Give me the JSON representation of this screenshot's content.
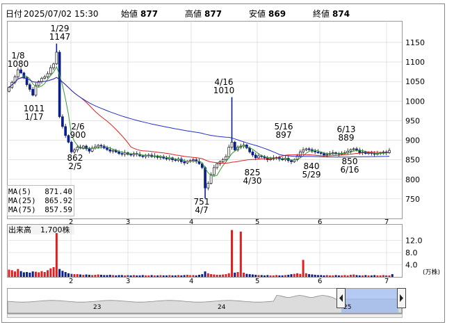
{
  "header": {
    "date_label": "日付",
    "datetime": "2025/07/02 15:30",
    "open_label": "始値",
    "open_value": "877",
    "high_label": "高値",
    "high_value": "877",
    "low_label": "安値",
    "low_value": "869",
    "close_label": "終値",
    "close_value": "874"
  },
  "colors": {
    "up": "#ffffff",
    "down": "#0a1e8c",
    "ma5": "#339933",
    "ma25": "#e02020",
    "ma75": "#2030c8",
    "high_text": "#e02020",
    "low_text": "#339933",
    "volume_up": "#e02020",
    "volume_down": "#0a1e8c",
    "grid": "#d0d0d0",
    "nav_fill": "#c8d8f0"
  },
  "legend": [
    {
      "label": "MA(5)",
      "value": "871.40",
      "color": "#339933"
    },
    {
      "label": "MA(25)",
      "value": "865.92",
      "color": "#e02020"
    },
    {
      "label": "MA(75)",
      "value": "857.59",
      "color": "#2030c8"
    }
  ],
  "volume_panel": {
    "title": "出来高",
    "value": "1,700株",
    "unit": "(万株)",
    "ticks": [
      "12.0",
      "8.0",
      "4.0"
    ]
  },
  "navigator": {
    "labels": [
      "23",
      "24",
      "25"
    ]
  },
  "chart_data": {
    "type": "candlestick",
    "x_ticks": [
      "2",
      "3",
      "4",
      "5",
      "6",
      "7"
    ],
    "y_ticks": [
      750,
      800,
      850,
      900,
      950,
      1000,
      1050,
      1100,
      1150
    ],
    "ylim": [
      700,
      1200
    ],
    "volume_ylim": [
      0,
      16
    ],
    "annotations": [
      {
        "date": "1/8",
        "value": "1080",
        "kind": "high"
      },
      {
        "date": "1/29",
        "value": "1147",
        "kind": "high"
      },
      {
        "date": "1/17",
        "value": "1011",
        "kind": "low"
      },
      {
        "date": "2/6",
        "value": "900",
        "kind": "high"
      },
      {
        "date": "2/5",
        "value": "862",
        "kind": "low"
      },
      {
        "date": "4/16",
        "value": "1010",
        "kind": "high"
      },
      {
        "date": "4/7",
        "value": "751",
        "kind": "low"
      },
      {
        "date": "4/30",
        "value": "825",
        "kind": "low"
      },
      {
        "date": "5/16",
        "value": "897",
        "kind": "high"
      },
      {
        "date": "5/29",
        "value": "840",
        "kind": "low"
      },
      {
        "date": "6/13",
        "value": "889",
        "kind": "high"
      },
      {
        "date": "6/16",
        "value": "850",
        "kind": "low"
      }
    ],
    "closes": [
      1035,
      1048,
      1062,
      1080,
      1072,
      1060,
      1042,
      1030,
      1015,
      1040,
      1050,
      1058,
      1062,
      1070,
      1085,
      1095,
      1125,
      960,
      935,
      912,
      895,
      870,
      875,
      882,
      880,
      885,
      878,
      872,
      880,
      883,
      887,
      885,
      880,
      876,
      872,
      874,
      870,
      866,
      864,
      868,
      864,
      862,
      866,
      864,
      860,
      858,
      861,
      862,
      858,
      860,
      856,
      858,
      854,
      852,
      855,
      850,
      848,
      852,
      845,
      842,
      846,
      848,
      850,
      846,
      840,
      830,
      778,
      790,
      812,
      830,
      840,
      845,
      850,
      858,
      882,
      895,
      875,
      882,
      885,
      888,
      880,
      870,
      862,
      855,
      860,
      858,
      855,
      850,
      852,
      855,
      856,
      852,
      850,
      854,
      848,
      845,
      850,
      860,
      870,
      875,
      878,
      876,
      872,
      870,
      868,
      866,
      862,
      864,
      866,
      868,
      866,
      864,
      867,
      868,
      872,
      876,
      878,
      875,
      868,
      870,
      866,
      868,
      866,
      864,
      866,
      868,
      870,
      868,
      874
    ],
    "volumes": [
      2.4,
      2.2,
      1.8,
      2.6,
      1.9,
      1.5,
      1.6,
      1.4,
      1.8,
      1.7,
      1.5,
      1.9,
      1.6,
      2.2,
      2.8,
      3.2,
      14.4,
      2.6,
      2.0,
      1.6,
      1.2,
      1.0,
      0.9,
      0.9,
      0.8,
      0.7,
      0.8,
      0.7,
      0.6,
      0.7,
      0.8,
      0.7,
      0.6,
      0.6,
      0.7,
      0.6,
      0.5,
      0.6,
      0.6,
      0.5,
      0.6,
      0.5,
      0.6,
      0.5,
      0.5,
      0.6,
      0.5,
      0.5,
      0.6,
      0.5,
      0.5,
      0.6,
      0.5,
      0.5,
      0.6,
      0.5,
      0.5,
      0.6,
      0.5,
      0.6,
      0.7,
      0.6,
      0.6,
      0.5,
      0.7,
      0.9,
      1.8,
      1.2,
      0.9,
      0.8,
      0.7,
      0.7,
      0.8,
      0.9,
      1.2,
      15.4,
      1.4,
      1.6,
      14.9,
      1.4,
      1.0,
      0.9,
      0.8,
      0.7,
      0.6,
      0.6,
      0.5,
      0.6,
      0.5,
      0.5,
      0.6,
      0.5,
      0.5,
      0.6,
      0.7,
      0.9,
      1.0,
      1.2,
      1.0,
      5.6,
      1.2,
      0.9,
      0.8,
      0.7,
      0.6,
      0.6,
      0.5,
      0.6,
      0.5,
      0.5,
      0.6,
      0.5,
      0.5,
      0.6,
      0.5,
      0.7,
      0.8,
      0.6,
      0.5,
      0.5,
      0.6,
      0.5,
      0.5,
      0.6,
      0.5,
      0.5,
      0.6,
      0.5,
      0.5,
      0.9
    ]
  }
}
